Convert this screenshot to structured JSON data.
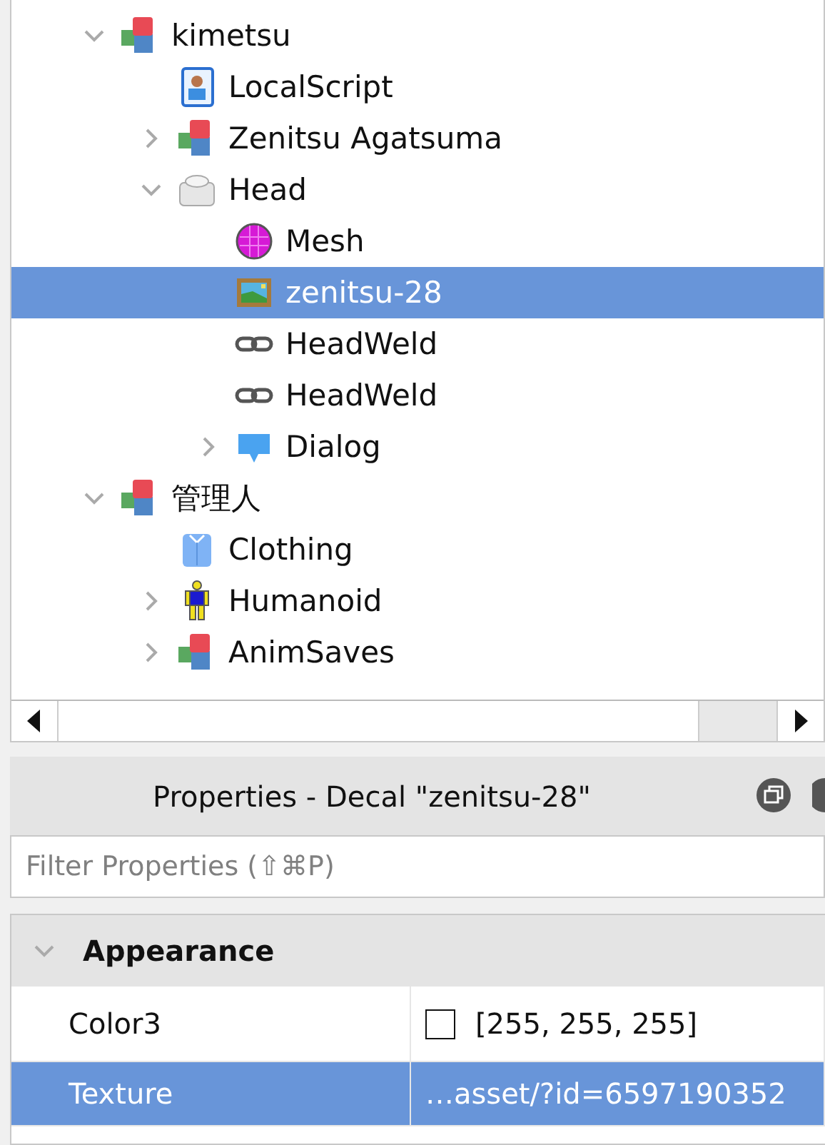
{
  "explorer": {
    "tree": [
      {
        "label": "kimetsu",
        "kind": "model",
        "expanded": true,
        "selected": false,
        "children": [
          {
            "label": "LocalScript",
            "kind": "script",
            "selected": false
          },
          {
            "label": "Zenitsu Agatsuma",
            "kind": "model",
            "expanded": false,
            "selected": false
          },
          {
            "label": "Head",
            "kind": "part",
            "expanded": true,
            "selected": false,
            "children": [
              {
                "label": "Mesh",
                "kind": "mesh",
                "selected": false
              },
              {
                "label": "zenitsu-28",
                "kind": "decal",
                "selected": true
              },
              {
                "label": "HeadWeld",
                "kind": "weld",
                "selected": false
              },
              {
                "label": "HeadWeld",
                "kind": "weld",
                "selected": false
              },
              {
                "label": "Dialog",
                "kind": "dialog",
                "expanded": false,
                "selected": false
              }
            ]
          }
        ]
      },
      {
        "label": "管理人",
        "kind": "model",
        "expanded": true,
        "selected": false,
        "children": [
          {
            "label": "Clothing",
            "kind": "clothing",
            "selected": false
          },
          {
            "label": "Humanoid",
            "kind": "humanoid",
            "expanded": false,
            "selected": false
          },
          {
            "label": "AnimSaves",
            "kind": "model",
            "expanded": false,
            "selected": false
          }
        ]
      }
    ]
  },
  "properties": {
    "title": "Properties - Decal \"zenitsu-28\"",
    "filter": {
      "placeholder": "Filter Properties (⇧⌘P)"
    },
    "groups": [
      {
        "name": "Appearance",
        "expanded": true,
        "rows": [
          {
            "name": "Color3",
            "value": "[255, 255, 255]",
            "color": "#ffffff",
            "selected": false
          },
          {
            "name": "Texture",
            "value": "…asset/?id=6597190352",
            "selected": true
          }
        ]
      }
    ]
  }
}
